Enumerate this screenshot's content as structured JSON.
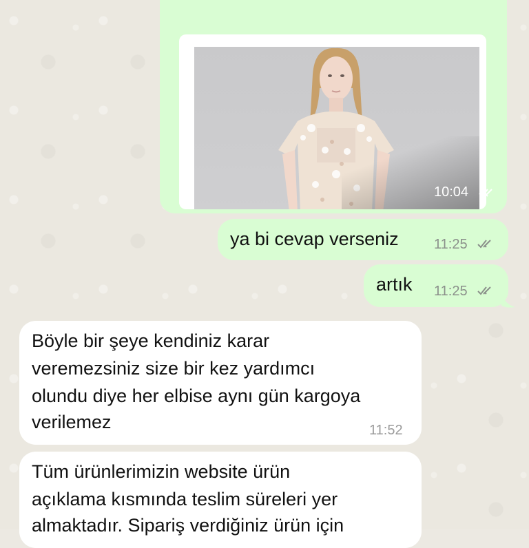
{
  "messages": [
    {
      "type": "image",
      "direction": "outgoing",
      "time": "10:04",
      "status": "read"
    },
    {
      "type": "text",
      "direction": "outgoing",
      "text": "ya bi cevap verseniz",
      "time": "11:25",
      "status": "read"
    },
    {
      "type": "text",
      "direction": "outgoing",
      "text": "artık",
      "time": "11:25",
      "status": "read"
    },
    {
      "type": "text",
      "direction": "incoming",
      "lines": [
        "Böyle bir şeye kendiniz karar",
        "veremezsiniz size bir kez yardımcı",
        "olundu diye her elbise aynı gün kargoya",
        "verilemez"
      ],
      "time": "11:52"
    },
    {
      "type": "text",
      "direction": "incoming",
      "lines": [
        "Tüm ürünlerimizin website ürün",
        "açıklama kısmında teslim süreleri yer",
        "almaktadır. Sipariş verdiğiniz ürün için"
      ],
      "time": ""
    }
  ],
  "colors": {
    "outgoing_bubble": "#d9fdd3",
    "incoming_bubble": "#ffffff",
    "wallpaper": "#ebe8e0",
    "tick": "#8a8f8a"
  },
  "icons": {
    "read_receipt": "double-check-icon"
  }
}
